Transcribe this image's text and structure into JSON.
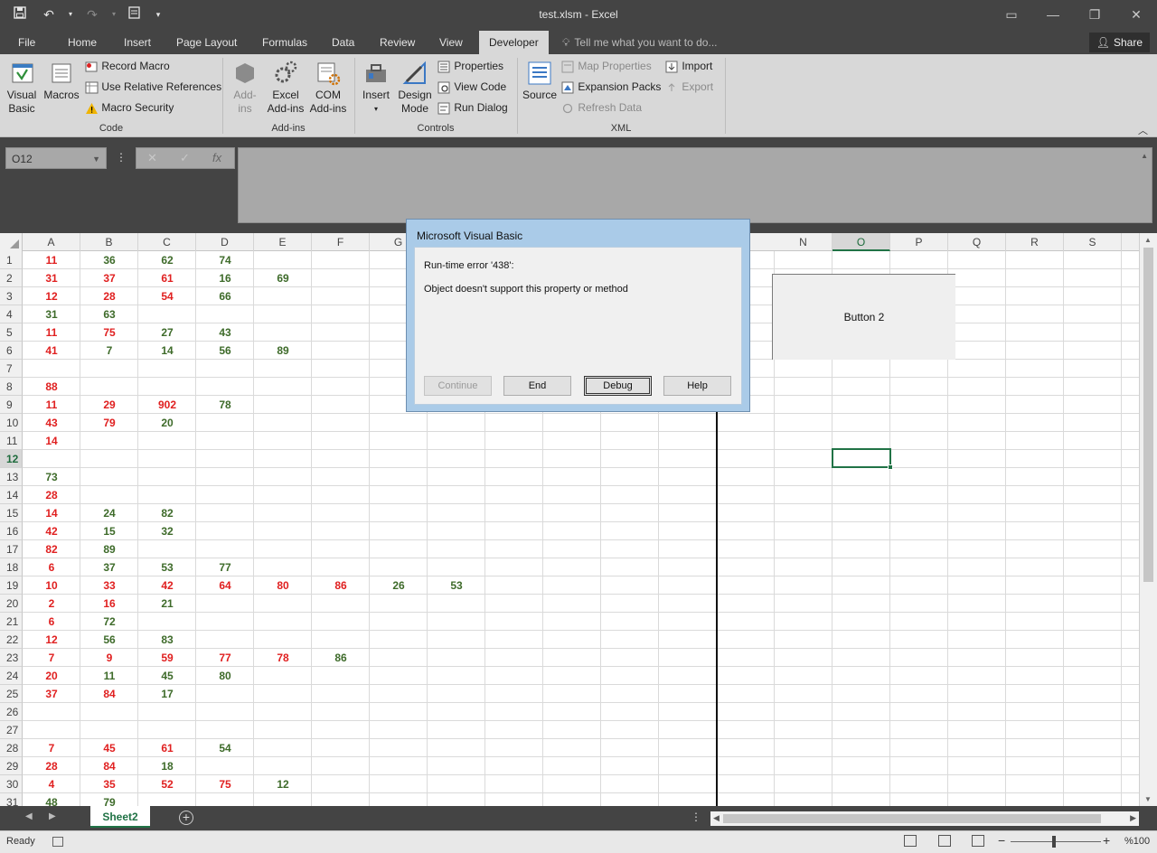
{
  "window": {
    "title": "test.xlsm - Excel"
  },
  "tabs": [
    "File",
    "Home",
    "Insert",
    "Page Layout",
    "Formulas",
    "Data",
    "Review",
    "View",
    "Developer"
  ],
  "tell_me": "Tell me what you want to do...",
  "share": "Share",
  "ribbon": {
    "code": {
      "label": "Code",
      "visual_basic": "Visual Basic",
      "macros": "Macros",
      "record_macro": "Record Macro",
      "relative_refs": "Use Relative References",
      "macro_security": "Macro Security"
    },
    "addins": {
      "label": "Add-ins",
      "addins_line1": "Add-",
      "addins_line2": "ins",
      "excel_line1": "Excel",
      "excel_line2": "Add-ins",
      "com_line1": "COM",
      "com_line2": "Add-ins"
    },
    "controls": {
      "label": "Controls",
      "insert": "Insert",
      "design_line1": "Design",
      "design_line2": "Mode",
      "properties": "Properties",
      "view_code": "View Code",
      "run_dialog": "Run Dialog"
    },
    "xml": {
      "label": "XML",
      "source": "Source",
      "map_properties": "Map Properties",
      "expansion_packs": "Expansion Packs",
      "refresh_data": "Refresh Data",
      "import": "Import",
      "export": "Export"
    }
  },
  "name_box": "O12",
  "columns": [
    "A",
    "B",
    "C",
    "D",
    "E",
    "F",
    "G",
    "H",
    "I",
    "J",
    "K",
    "L",
    "M",
    "N",
    "O",
    "P",
    "Q",
    "R",
    "S"
  ],
  "visible_columns": [
    {
      "name": "A",
      "sel": false
    },
    {
      "name": "B",
      "sel": false
    },
    {
      "name": "C",
      "sel": false
    },
    {
      "name": "D",
      "sel": false
    },
    {
      "name": "E",
      "sel": false
    },
    {
      "name": "F",
      "sel": false
    },
    {
      "name": "G",
      "sel": false
    },
    {
      "name": "N",
      "sel": false
    },
    {
      "name": "O",
      "sel": true
    },
    {
      "name": "P",
      "sel": false
    },
    {
      "name": "Q",
      "sel": false
    },
    {
      "name": "R",
      "sel": false
    },
    {
      "name": "S",
      "sel": false
    }
  ],
  "selected_row": 12,
  "cells": [
    {
      "r": 1,
      "c": "A",
      "v": "11",
      "color": "red"
    },
    {
      "r": 1,
      "c": "B",
      "v": "36",
      "color": "green"
    },
    {
      "r": 1,
      "c": "C",
      "v": "62",
      "color": "green"
    },
    {
      "r": 1,
      "c": "D",
      "v": "74",
      "color": "green"
    },
    {
      "r": 2,
      "c": "A",
      "v": "31",
      "color": "red"
    },
    {
      "r": 2,
      "c": "B",
      "v": "37",
      "color": "red"
    },
    {
      "r": 2,
      "c": "C",
      "v": "61",
      "color": "red"
    },
    {
      "r": 2,
      "c": "D",
      "v": "16",
      "color": "green"
    },
    {
      "r": 2,
      "c": "E",
      "v": "69",
      "color": "green"
    },
    {
      "r": 3,
      "c": "A",
      "v": "12",
      "color": "red"
    },
    {
      "r": 3,
      "c": "B",
      "v": "28",
      "color": "red"
    },
    {
      "r": 3,
      "c": "C",
      "v": "54",
      "color": "red"
    },
    {
      "r": 3,
      "c": "D",
      "v": "66",
      "color": "green"
    },
    {
      "r": 4,
      "c": "A",
      "v": "31",
      "color": "green"
    },
    {
      "r": 4,
      "c": "B",
      "v": "63",
      "color": "green"
    },
    {
      "r": 5,
      "c": "A",
      "v": "11",
      "color": "red"
    },
    {
      "r": 5,
      "c": "B",
      "v": "75",
      "color": "red"
    },
    {
      "r": 5,
      "c": "C",
      "v": "27",
      "color": "green"
    },
    {
      "r": 5,
      "c": "D",
      "v": "43",
      "color": "green"
    },
    {
      "r": 6,
      "c": "A",
      "v": "41",
      "color": "red"
    },
    {
      "r": 6,
      "c": "B",
      "v": "7",
      "color": "green"
    },
    {
      "r": 6,
      "c": "C",
      "v": "14",
      "color": "green"
    },
    {
      "r": 6,
      "c": "D",
      "v": "56",
      "color": "green"
    },
    {
      "r": 6,
      "c": "E",
      "v": "89",
      "color": "green"
    },
    {
      "r": 8,
      "c": "A",
      "v": "88",
      "color": "red"
    },
    {
      "r": 9,
      "c": "A",
      "v": "11",
      "color": "red"
    },
    {
      "r": 9,
      "c": "B",
      "v": "29",
      "color": "red"
    },
    {
      "r": 9,
      "c": "C",
      "v": "902",
      "color": "red"
    },
    {
      "r": 9,
      "c": "D",
      "v": "78",
      "color": "green"
    },
    {
      "r": 10,
      "c": "A",
      "v": "43",
      "color": "red"
    },
    {
      "r": 10,
      "c": "B",
      "v": "79",
      "color": "red"
    },
    {
      "r": 10,
      "c": "C",
      "v": "20",
      "color": "green"
    },
    {
      "r": 11,
      "c": "A",
      "v": "14",
      "color": "red"
    },
    {
      "r": 13,
      "c": "A",
      "v": "73",
      "color": "green"
    },
    {
      "r": 14,
      "c": "A",
      "v": "28",
      "color": "red"
    },
    {
      "r": 15,
      "c": "A",
      "v": "14",
      "color": "red"
    },
    {
      "r": 15,
      "c": "B",
      "v": "24",
      "color": "green"
    },
    {
      "r": 15,
      "c": "C",
      "v": "82",
      "color": "green"
    },
    {
      "r": 16,
      "c": "A",
      "v": "42",
      "color": "red"
    },
    {
      "r": 16,
      "c": "B",
      "v": "15",
      "color": "green"
    },
    {
      "r": 16,
      "c": "C",
      "v": "32",
      "color": "green"
    },
    {
      "r": 17,
      "c": "A",
      "v": "82",
      "color": "red"
    },
    {
      "r": 17,
      "c": "B",
      "v": "89",
      "color": "green"
    },
    {
      "r": 18,
      "c": "A",
      "v": "6",
      "color": "red"
    },
    {
      "r": 18,
      "c": "B",
      "v": "37",
      "color": "green"
    },
    {
      "r": 18,
      "c": "C",
      "v": "53",
      "color": "green"
    },
    {
      "r": 18,
      "c": "D",
      "v": "77",
      "color": "green"
    },
    {
      "r": 19,
      "c": "A",
      "v": "10",
      "color": "red"
    },
    {
      "r": 19,
      "c": "B",
      "v": "33",
      "color": "red"
    },
    {
      "r": 19,
      "c": "C",
      "v": "42",
      "color": "red"
    },
    {
      "r": 19,
      "c": "D",
      "v": "64",
      "color": "red"
    },
    {
      "r": 19,
      "c": "E",
      "v": "80",
      "color": "red"
    },
    {
      "r": 19,
      "c": "F",
      "v": "86",
      "color": "red"
    },
    {
      "r": 19,
      "c": "G",
      "v": "26",
      "color": "green"
    },
    {
      "r": 19,
      "c": "H",
      "v": "53",
      "color": "green"
    },
    {
      "r": 20,
      "c": "A",
      "v": "2",
      "color": "red"
    },
    {
      "r": 20,
      "c": "B",
      "v": "16",
      "color": "red"
    },
    {
      "r": 20,
      "c": "C",
      "v": "21",
      "color": "green"
    },
    {
      "r": 21,
      "c": "A",
      "v": "6",
      "color": "red"
    },
    {
      "r": 21,
      "c": "B",
      "v": "72",
      "color": "green"
    },
    {
      "r": 22,
      "c": "A",
      "v": "12",
      "color": "red"
    },
    {
      "r": 22,
      "c": "B",
      "v": "56",
      "color": "green"
    },
    {
      "r": 22,
      "c": "C",
      "v": "83",
      "color": "green"
    },
    {
      "r": 23,
      "c": "A",
      "v": "7",
      "color": "red"
    },
    {
      "r": 23,
      "c": "B",
      "v": "9",
      "color": "red"
    },
    {
      "r": 23,
      "c": "C",
      "v": "59",
      "color": "red"
    },
    {
      "r": 23,
      "c": "D",
      "v": "77",
      "color": "red"
    },
    {
      "r": 23,
      "c": "E",
      "v": "78",
      "color": "red"
    },
    {
      "r": 23,
      "c": "F",
      "v": "86",
      "color": "green"
    },
    {
      "r": 24,
      "c": "A",
      "v": "20",
      "color": "red"
    },
    {
      "r": 24,
      "c": "B",
      "v": "11",
      "color": "green"
    },
    {
      "r": 24,
      "c": "C",
      "v": "45",
      "color": "green"
    },
    {
      "r": 24,
      "c": "D",
      "v": "80",
      "color": "green"
    },
    {
      "r": 25,
      "c": "A",
      "v": "37",
      "color": "red"
    },
    {
      "r": 25,
      "c": "B",
      "v": "84",
      "color": "red"
    },
    {
      "r": 25,
      "c": "C",
      "v": "17",
      "color": "green"
    },
    {
      "r": 28,
      "c": "A",
      "v": "7",
      "color": "red"
    },
    {
      "r": 28,
      "c": "B",
      "v": "45",
      "color": "red"
    },
    {
      "r": 28,
      "c": "C",
      "v": "61",
      "color": "red"
    },
    {
      "r": 28,
      "c": "D",
      "v": "54",
      "color": "green"
    },
    {
      "r": 29,
      "c": "A",
      "v": "28",
      "color": "red"
    },
    {
      "r": 29,
      "c": "B",
      "v": "84",
      "color": "red"
    },
    {
      "r": 29,
      "c": "C",
      "v": "18",
      "color": "green"
    },
    {
      "r": 30,
      "c": "A",
      "v": "4",
      "color": "red"
    },
    {
      "r": 30,
      "c": "B",
      "v": "35",
      "color": "red"
    },
    {
      "r": 30,
      "c": "C",
      "v": "52",
      "color": "red"
    },
    {
      "r": 30,
      "c": "D",
      "v": "75",
      "color": "red"
    },
    {
      "r": 30,
      "c": "E",
      "v": "12",
      "color": "green"
    },
    {
      "r": 31,
      "c": "A",
      "v": "48",
      "color": "green"
    },
    {
      "r": 31,
      "c": "B",
      "v": "79",
      "color": "green"
    }
  ],
  "sheet_button": "Button 2",
  "sheet_tab": "Sheet2",
  "status": "Ready",
  "zoom": "%100",
  "dialog": {
    "title": "Microsoft Visual Basic",
    "error_line": "Run-time error '438':",
    "message": "Object doesn't support this property or method",
    "buttons": {
      "continue": "Continue",
      "end": "End",
      "debug": "Debug",
      "help": "Help"
    }
  },
  "colors": {
    "accent_green": "#217346",
    "value_red": "#e02020",
    "value_green": "#3e6b2a",
    "dialog_frame": "#aacbe8"
  }
}
